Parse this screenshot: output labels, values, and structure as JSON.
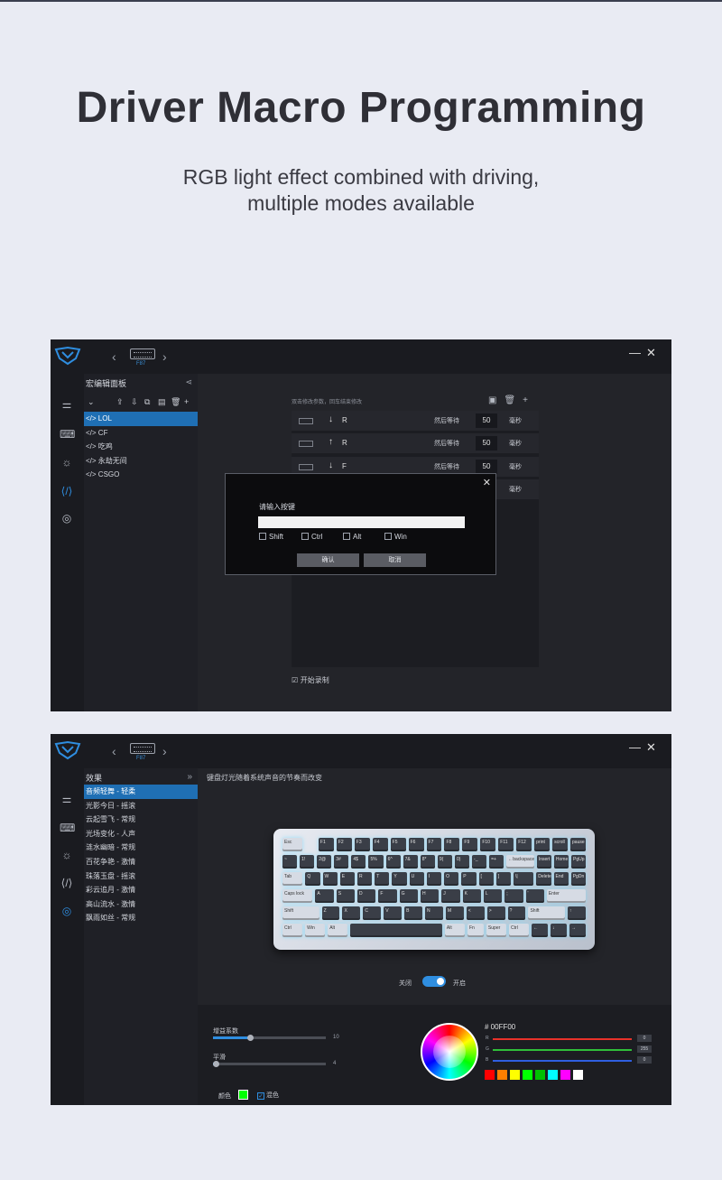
{
  "heading": "Driver Macro Programming",
  "subheading_line1": "RGB light effect combined with driving,",
  "subheading_line2": "multiple modes available",
  "model": "F87",
  "macro_screen": {
    "panel_title": "宏编辑面板",
    "items": [
      "</> LOL",
      "</> CF",
      "</> 吃鸡",
      "</> 永劫无间",
      "</> CSGO"
    ],
    "editor_hint": "双击修改参数，回车结束修改",
    "rows": [
      {
        "arrow": "↓",
        "key": "R",
        "label": "然后等待",
        "value": "50",
        "unit": "毫秒"
      },
      {
        "arrow": "↑",
        "key": "R",
        "label": "然后等待",
        "value": "50",
        "unit": "毫秒"
      },
      {
        "arrow": "↓",
        "key": "F",
        "label": "然后等待",
        "value": "50",
        "unit": "毫秒"
      },
      {
        "arrow": "",
        "key": "",
        "label": "",
        "value": "",
        "unit": "毫秒"
      }
    ],
    "record_label": "☑ 开始录制",
    "dialog": {
      "title": "请输入按键",
      "checks": [
        "Shift",
        "Ctrl",
        "Alt",
        "Win"
      ],
      "confirm": "确认",
      "cancel": "取消"
    }
  },
  "light_screen": {
    "panel_title": "效果",
    "items": [
      "音频轻舞 - 轻柔",
      "光影今日 - 摇滚",
      "云起雪飞 - 常规",
      "光场变化 - 人声",
      "涟水幽暗 - 常规",
      "百花争艳 - 激情",
      "珠落玉盘 - 摇滚",
      "彩云追月 - 激情",
      "高山流水 - 激情",
      "飘雨如丝 - 常规"
    ],
    "description": "键盘灯光随着系统声音的节奏而改变",
    "toggle_off": "关闭",
    "toggle_on": "开启",
    "toggle_state": true,
    "gain_label": "增益系数",
    "gain_value": "10",
    "gain_fraction": 0.33,
    "smooth_label": "平滑",
    "smooth_value": "4",
    "smooth_fraction": 0.02,
    "color_label": "颜色",
    "mix_label": "混色",
    "hex": "# 00FF00",
    "r_label": "R",
    "g_label": "G",
    "b_label": "B",
    "r_value": "0",
    "g_value": "255",
    "b_value": "0",
    "palette": [
      "#ff0000",
      "#ff7f00",
      "#ffff00",
      "#00ff00",
      "#00c000",
      "#00ffff",
      "#ff00ff",
      "#ffffff"
    ]
  },
  "keyboard": {
    "rows": [
      [
        "Esc",
        "",
        "F1",
        "F2",
        "F3",
        "F4",
        "F5",
        "F6",
        "F7",
        "F8",
        "F9",
        "F10",
        "F11",
        "F12",
        "print",
        "scroll",
        "pause"
      ],
      [
        "~",
        "1!",
        "2@",
        "3#",
        "4$",
        "5%",
        "6^",
        "7&",
        "8*",
        "9(",
        "0)",
        "-_",
        "=+",
        "←backspace",
        "Insert",
        "Home",
        "PgUp"
      ],
      [
        "Tab",
        "Q",
        "W",
        "E",
        "R",
        "T",
        "Y",
        "U",
        "I",
        "O",
        "P",
        "[",
        "]",
        "\\|",
        "Delete",
        "End",
        "PgDn"
      ],
      [
        "Caps lock",
        "A",
        "S",
        "D",
        "F",
        "G",
        "H",
        "J",
        "K",
        "L",
        ";",
        "'",
        "Enter"
      ],
      [
        "Shift",
        "Z",
        "X",
        "C",
        "V",
        "B",
        "N",
        "M",
        "<",
        ">",
        "?",
        "Shift",
        "↑"
      ],
      [
        "Ctrl",
        "Win",
        "Alt",
        "",
        "Alt",
        "Fn",
        "Super",
        "Ctrl",
        "←",
        "↓",
        "→"
      ]
    ]
  }
}
